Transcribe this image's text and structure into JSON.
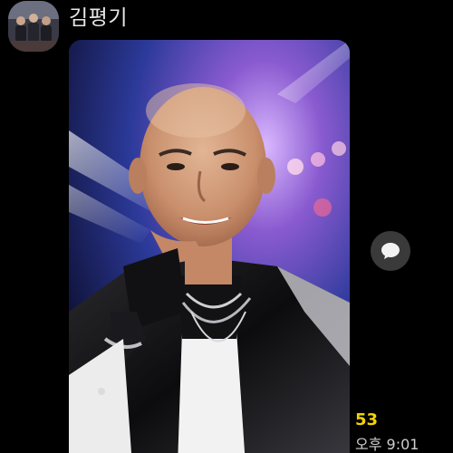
{
  "chat": {
    "sender_name": "김평기",
    "avatar_icon": "group-photo-avatar",
    "message_photo_icon": "portrait-photo",
    "share_icon": "speech-bubble-icon",
    "unread_count": "53",
    "timestamp": "오후 9:01"
  },
  "colors": {
    "background": "#000000",
    "unread_count": "#f2d200",
    "timestamp": "#cfcfcf",
    "name": "#e6e6e6",
    "share_button_bg": "#3a3a3a"
  }
}
